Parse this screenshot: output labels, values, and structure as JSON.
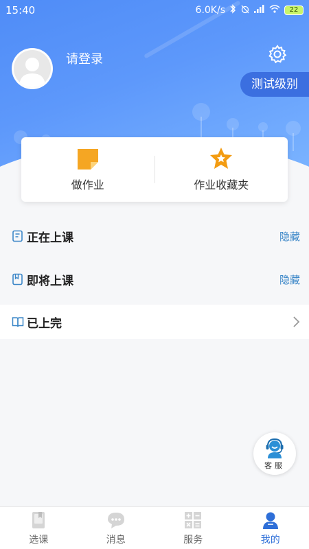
{
  "status_bar": {
    "time": "15:40",
    "network_speed": "6.0K/s",
    "battery": "22"
  },
  "profile": {
    "login_prompt": "请登录",
    "level_button": "测试级别"
  },
  "quick_actions": [
    {
      "label": "做作业",
      "icon": "homework-icon"
    },
    {
      "label": "作业收藏夹",
      "icon": "star-folder-icon"
    }
  ],
  "sections": {
    "in_class": {
      "title": "正在上课",
      "action": "隐藏"
    },
    "upcoming": {
      "title": "即将上课",
      "action": "隐藏"
    },
    "finished": {
      "title": "已上完"
    }
  },
  "customer_service": {
    "label": "客服"
  },
  "tabs": [
    {
      "label": "选课",
      "icon": "book-icon",
      "active": false
    },
    {
      "label": "消息",
      "icon": "chat-icon",
      "active": false
    },
    {
      "label": "服务",
      "icon": "calculator-icon",
      "active": false
    },
    {
      "label": "我的",
      "icon": "user-icon",
      "active": true
    }
  ],
  "colors": {
    "header_blue": "#5d98fb",
    "accent_blue": "#3b6fe0",
    "link_blue": "#3c87c8",
    "active_tab": "#2e6fd8",
    "icon_orange": "#f5a623"
  }
}
